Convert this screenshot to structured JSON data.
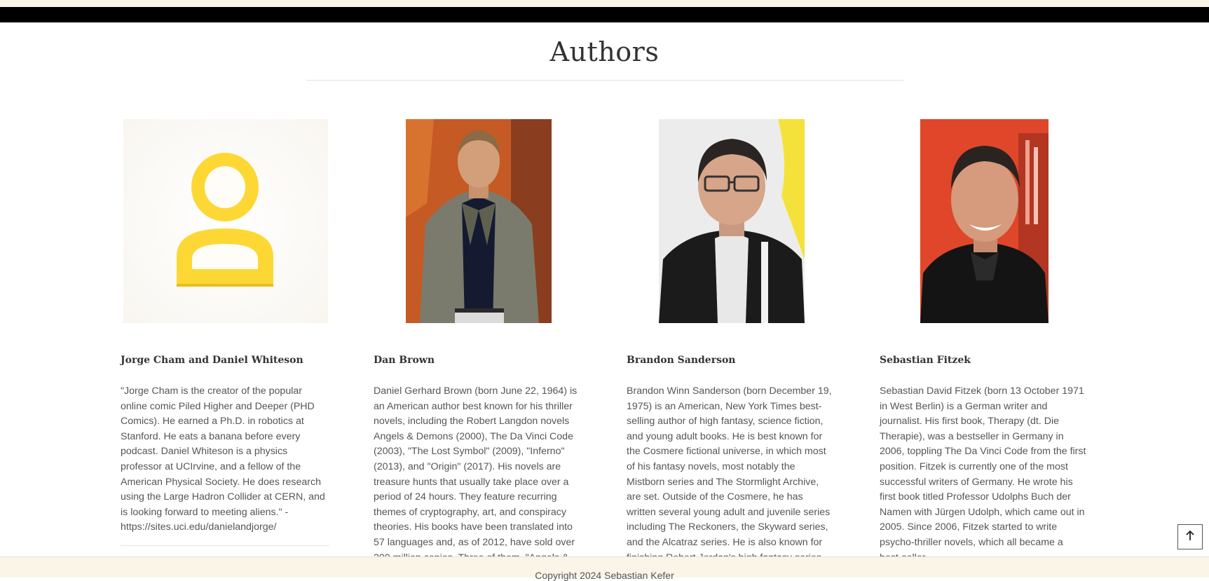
{
  "page": {
    "title": "Authors"
  },
  "authors": [
    {
      "name": "Jorge Cham and Daniel Whiteson",
      "photo": "do-logo-icon",
      "bio": "\"Jorge Cham is the creator of the popular online comic Piled Higher and Deeper (PHD Comics). He earned a Ph.D. in robotics at Stanford. He eats a banana before every podcast. Daniel Whiteson is a physics professor at UCIrvine, and a fellow of the American Physical Society. He does research using the Large Hadron Collider at CERN, and is looking forward to meeting aliens.\" - https://sites.uci.edu/danielandjorge/"
    },
    {
      "name": "Dan Brown",
      "photo": "dan-brown-portrait",
      "bio": "Daniel Gerhard Brown (born June 22, 1964) is an American author best known for his thriller novels, including the Robert Langdon novels Angels & Demons (2000), The Da Vinci Code (2003), \"The Lost Symbol\" (2009), \"Inferno\" (2013), and \"Origin\" (2017). His novels are treasure hunts that usually take place over a period of 24 hours. They feature recurring themes of cryptography, art, and conspiracy theories. His books have been translated into 57 languages and, as of 2012, have sold over 200 million copies. Three of them, \"Angels &"
    },
    {
      "name": "Brandon Sanderson",
      "photo": "brandon-sanderson-portrait",
      "bio": "Brandon Winn Sanderson (born December 19, 1975) is an American, New York Times best-selling author of high fantasy, science fiction, and young adult books. He is best known for the Cosmere fictional universe, in which most of his fantasy novels, most notably the Mistborn series and The Stormlight Archive, are set. Outside of the Cosmere, he has written several young adult and juvenile series including The Reckoners, the Skyward series, and the Alcatraz series. He is also known for finishing Robert Jordan's high fantasy series"
    },
    {
      "name": "Sebastian Fitzek",
      "photo": "sebastian-fitzek-portrait",
      "bio": "Sebastian David Fitzek (born 13 October 1971 in West Berlin) is a German writer and journalist. His first book, Therapy (dt. Die Therapie), was a bestseller in Germany in 2006, toppling The Da Vinci Code from the first position. Fitzek is currently one of the most successful writers of Germany. He wrote his first book titled Professor Udolphs Buch der Namen with Jürgen Udolph, which came out in 2005. Since 2006, Fitzek started to write psycho-thriller novels, which all became a best-seller."
    }
  ],
  "footer": {
    "copyright": "Copyright 2024 Sebastian Kefer"
  },
  "controls": {
    "back_to_top_icon": "arrow-up-icon"
  },
  "colors": {
    "header_strip": "#fbf5e8",
    "nav_bar": "#000000",
    "footer_bg": "#fbf5e8",
    "logo_yellow": "#fdd835"
  }
}
